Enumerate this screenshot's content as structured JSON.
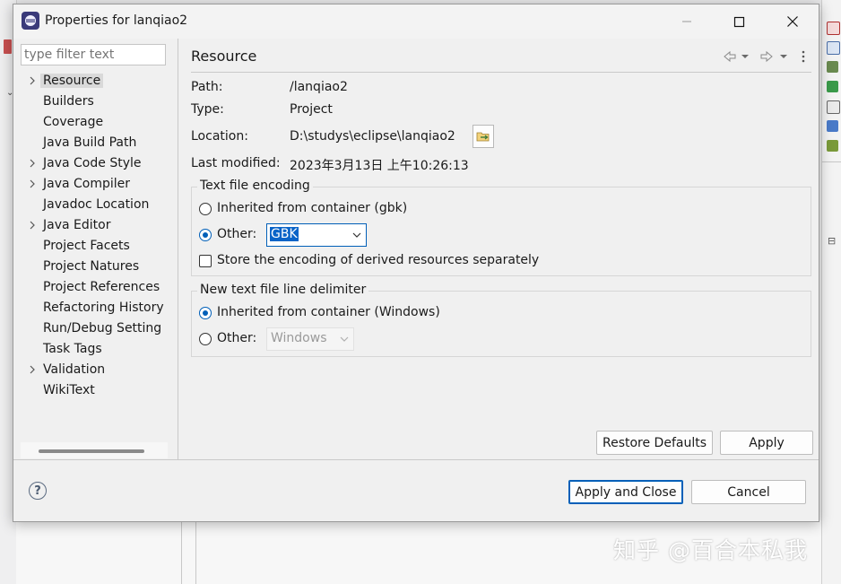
{
  "dialog": {
    "title": "Properties for lanqiao2"
  },
  "filter": {
    "placeholder": "type filter text"
  },
  "tree": [
    {
      "label": "Resource",
      "expandable": true,
      "selected": true
    },
    {
      "label": "Builders",
      "expandable": false
    },
    {
      "label": "Coverage",
      "expandable": false
    },
    {
      "label": "Java Build Path",
      "expandable": false
    },
    {
      "label": "Java Code Style",
      "expandable": true
    },
    {
      "label": "Java Compiler",
      "expandable": true
    },
    {
      "label": "Javadoc Location",
      "expandable": false
    },
    {
      "label": "Java Editor",
      "expandable": true
    },
    {
      "label": "Project Facets",
      "expandable": false
    },
    {
      "label": "Project Natures",
      "expandable": false
    },
    {
      "label": "Project References",
      "expandable": false
    },
    {
      "label": "Refactoring History",
      "expandable": false
    },
    {
      "label": "Run/Debug Setting",
      "expandable": false
    },
    {
      "label": "Task Tags",
      "expandable": false
    },
    {
      "label": "Validation",
      "expandable": true
    },
    {
      "label": "WikiText",
      "expandable": false
    }
  ],
  "page": {
    "title": "Resource",
    "path_label": "Path:",
    "path_value": "/lanqiao2",
    "type_label": "Type:",
    "type_value": "Project",
    "location_label": "Location:",
    "location_value": "D:\\studys\\eclipse\\lanqiao2",
    "modified_label": "Last modified:",
    "modified_value": "2023年3月13日 上午10:26:13"
  },
  "encoding": {
    "group_title": "Text file encoding",
    "inherited_label": "Inherited from container (gbk)",
    "other_label": "Other:",
    "other_value": "GBK",
    "store_label": "Store the encoding of derived resources separately"
  },
  "delimiter": {
    "group_title": "New text file line delimiter",
    "inherited_label": "Inherited from container (Windows)",
    "other_label": "Other:",
    "other_value": "Windows"
  },
  "buttons": {
    "restore_defaults": "Restore Defaults",
    "apply": "Apply",
    "apply_and_close": "Apply and Close",
    "cancel": "Cancel",
    "help": "?"
  },
  "watermark": "知乎 @百合本私我",
  "colors": {
    "accent": "#005fb8",
    "selection": "#0a64c8",
    "tree_selected_bg": "#d9d9d9"
  }
}
